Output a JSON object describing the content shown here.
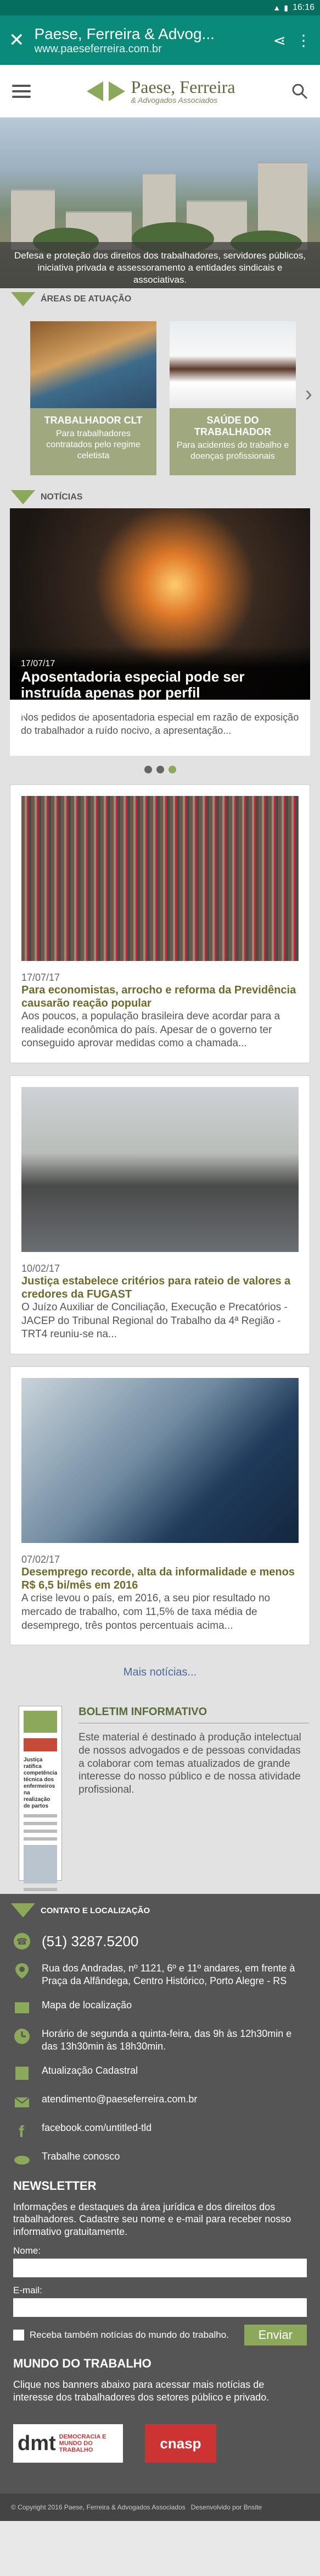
{
  "status_bar": {
    "time": "16:16"
  },
  "browser": {
    "title": "Paese, Ferreira & Advog...",
    "url": "www.paeseferreira.com.br"
  },
  "header": {
    "logo_name": "Paese, Ferreira",
    "logo_sub": "& Advogados Associados"
  },
  "hero": {
    "caption": "Defesa e proteção dos direitos dos trabalhadores, servidores públicos, iniciativa privada e assessoramento a entidades sindicais e associativas."
  },
  "areas": {
    "section_title": "ÁREAS DE ATUAÇÃO",
    "items": [
      {
        "title": "TRABALHADOR CLT",
        "desc": "Para trabalhadores contratados pelo regime celetista"
      },
      {
        "title": "SAÚDE DO TRABALHADOR",
        "desc": "Para acidentes do trabalho e doenças profissionais"
      }
    ]
  },
  "news": {
    "section_title": "NOTÍCIAS",
    "featured": {
      "date": "17/07/17",
      "title": "Aposentadoria especial pode ser instruída apenas por perfil profissiográfico",
      "summary": "Nos pedidos de aposentadoria especial em razão de exposição do trabalhador a ruído nocivo, a apresentação..."
    },
    "items": [
      {
        "date": "17/07/17",
        "title": "Para economistas, arrocho e reforma da Previdência causarão reação popular",
        "summary": "Aos poucos, a população brasileira deve acordar para a realidade econômica do país. Apesar de o governo ter conseguido aprovar medidas como a chamada..."
      },
      {
        "date": "10/02/17",
        "title": "Justiça estabelece critérios para rateio de valores a credores da FUGAST",
        "summary": "O Juízo Auxiliar de Conciliação, Execução e Precatórios - JACEP do Tribunal Regional do Trabalho da 4ª Região - TRT4 reuniu-se na..."
      },
      {
        "date": "07/02/17",
        "title": "Desemprego recorde, alta da informalidade e menos R$ 6,5 bi/mês em 2016",
        "summary": "A crise levou o país, em 2016, a seu pior resultado no mercado de trabalho, com 11,5% de taxa média de desemprego, três pontos percentuais acima..."
      }
    ],
    "more_link": "Mais notícias..."
  },
  "boletim": {
    "title": "BOLETIM INFORMATIVO",
    "text": "Este material é destinado à produção intelectual de nossos advogados e de pessoas convidadas a colaborar com temas atualizados de grande interesse do nosso público e de nossa atividade profissional.",
    "thumb_headline": "Justiça ratifica competência técnica dos enfermeiros na realização de partos"
  },
  "footer": {
    "contact_title": "CONTATO E LOCALIZAÇÃO",
    "phone": "(51) 3287.5200",
    "address": "Rua dos Andradas, nº 1121, 6º e 11º andares, em frente à Praça da Alfândega, Centro Histórico, Porto Alegre - RS",
    "map_link": "Mapa de localização",
    "hours": "Horário de segunda a quinta-feira, das 9h às 12h30min e das 13h30min às 18h30min.",
    "update_link": "Atualização Cadastral",
    "email": "atendimento@paeseferreira.com.br",
    "facebook": "facebook.com/untitled-tld",
    "work_link": "Trabalhe conosco",
    "newsletter_title": "NEWSLETTER",
    "newsletter_text": "Informações e destaques da área jurídica e dos direitos dos trabalhadores. Cadastre seu nome e e-mail para receber nosso informativo gratuitamente.",
    "name_label": "Nome:",
    "email_label": "E-mail:",
    "checkbox_label": "Receba também notícias do mundo do trabalho.",
    "send_label": "Enviar",
    "mundo_title": "MUNDO DO TRABALHO",
    "mundo_text": "Clique nos banners abaixo para acessar mais notícias de interesse dos trabalhadores dos setores público e privado.",
    "dmt_big": "dmt",
    "dmt_small": "DEMOCRACIA E MUNDO DO TRABALHO",
    "cnasp": "cnasp",
    "copyright": "© Copyright 2016 Paese, Ferreira & Advogados Associados",
    "credit": "Desenvolvido por Bnsite"
  },
  "colors": {
    "brand_green": "#8ca85a",
    "browser_teal": "#0a8a78",
    "footer_gray": "#555555"
  }
}
